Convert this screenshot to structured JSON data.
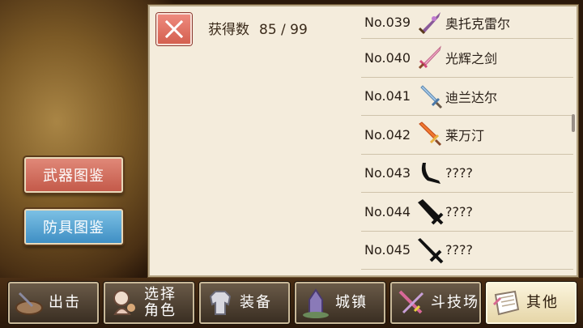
{
  "sidebar": {
    "weapon_catalog": "武器图鉴",
    "armor_catalog": "防具图鉴"
  },
  "panel": {
    "count_label": "获得数",
    "count_value": "85 / 99",
    "items": [
      {
        "no": "No.039",
        "name": "奥托克雷尔",
        "icon": "purple-sword-icon"
      },
      {
        "no": "No.040",
        "name": "光辉之剑",
        "icon": "pink-sword-icon"
      },
      {
        "no": "No.041",
        "name": "迪兰达尔",
        "icon": "blue-sword-icon"
      },
      {
        "no": "No.042",
        "name": "莱万汀",
        "icon": "flame-sword-icon"
      },
      {
        "no": "No.043",
        "name": "????",
        "icon": "unknown-scimitar-icon"
      },
      {
        "no": "No.044",
        "name": "????",
        "icon": "unknown-broadsword-icon"
      },
      {
        "no": "No.045",
        "name": "????",
        "icon": "unknown-sword-icon"
      }
    ]
  },
  "nav": {
    "sortie": "出击",
    "select_line1": "选择",
    "select_line2": "角色",
    "equip": "装备",
    "town": "城镇",
    "arena": "斗技场",
    "other": "其他"
  }
}
